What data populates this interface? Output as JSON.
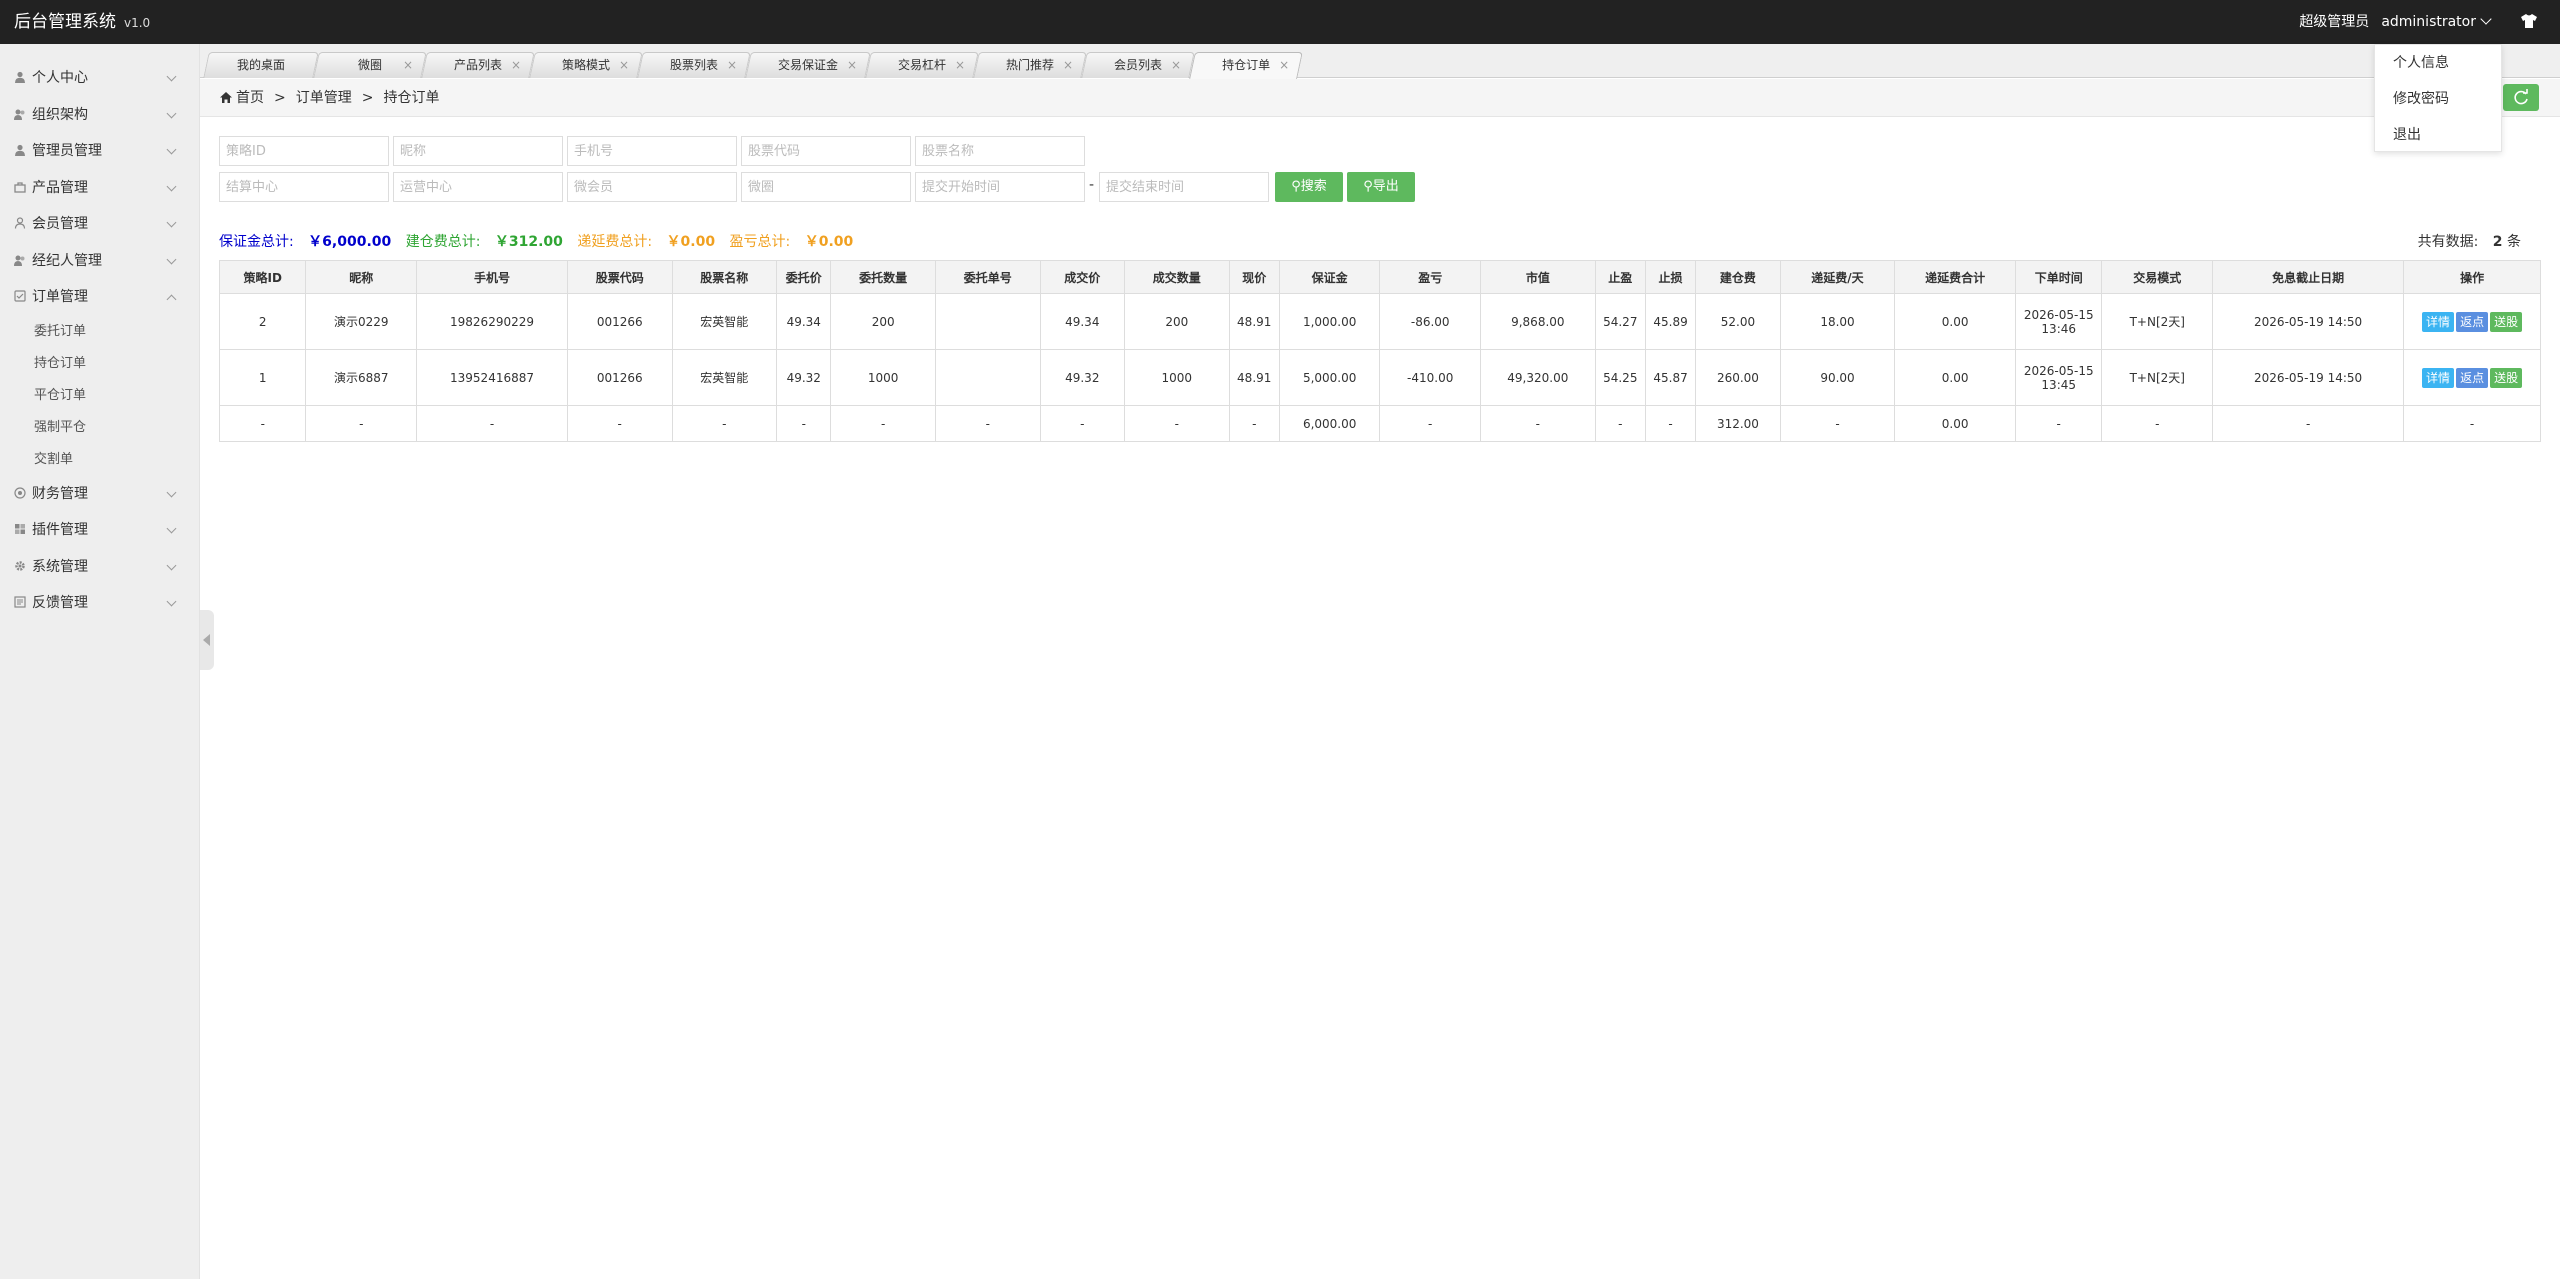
{
  "app": {
    "title": "后台管理系统",
    "version": "v1.0"
  },
  "user": {
    "role": "超级管理员",
    "name": "administrator"
  },
  "user_menu": [
    "个人信息",
    "修改密码",
    "退出"
  ],
  "sidebar": {
    "items": [
      {
        "label": "个人中心",
        "icon": "user-icon"
      },
      {
        "label": "组织架构",
        "icon": "org-icon"
      },
      {
        "label": "管理员管理",
        "icon": "admin-icon"
      },
      {
        "label": "产品管理",
        "icon": "product-icon"
      },
      {
        "label": "会员管理",
        "icon": "member-icon"
      },
      {
        "label": "经纪人管理",
        "icon": "broker-icon"
      },
      {
        "label": "订单管理",
        "icon": "order-icon",
        "expanded": true,
        "children": [
          "委托订单",
          "持仓订单",
          "平仓订单",
          "强制平仓",
          "交割单"
        ]
      },
      {
        "label": "财务管理",
        "icon": "finance-icon"
      },
      {
        "label": "插件管理",
        "icon": "plugin-icon"
      },
      {
        "label": "系统管理",
        "icon": "system-icon"
      },
      {
        "label": "反馈管理",
        "icon": "feedback-icon"
      }
    ]
  },
  "tabs": [
    "我的桌面",
    "微圈",
    "产品列表",
    "策略模式",
    "股票列表",
    "交易保证金",
    "交易杠杆",
    "热门推荐",
    "会员列表",
    "持仓订单"
  ],
  "breadcrumb": {
    "home": "首页",
    "level1": "订单管理",
    "level2": "持仓订单"
  },
  "search": {
    "placeholders": {
      "strategy_id": "策略ID",
      "nickname": "昵称",
      "phone": "手机号",
      "stock_code": "股票代码",
      "stock_name": "股票名称",
      "settle_center": "结算中心",
      "ops_center": "运营中心",
      "micro_member": "微会员",
      "micro_circle": "微圈",
      "start_time": "提交开始时间",
      "end_time": "提交结束时间"
    },
    "dash": "-",
    "search_label": "搜索",
    "export_label": "导出"
  },
  "summary": {
    "margin_label": "保证金总计:",
    "margin_value": "￥6,000.00",
    "build_fee_label": "建仓费总计:",
    "build_fee_value": "￥312.00",
    "defer_fee_label": "递延费总计:",
    "defer_fee_value": "￥0.00",
    "pnl_label": "盈亏总计:",
    "pnl_value": "￥0.00",
    "count_label": "共有数据:",
    "count_value": "2",
    "count_unit": "条",
    "colors": {
      "margin": "#0000cc",
      "build_fee": "#2fa533",
      "defer_fee": "#f0a020",
      "pnl": "#f0a020"
    }
  },
  "table": {
    "columns": [
      "策略ID",
      "昵称",
      "手机号",
      "股票代码",
      "股票名称",
      "委托价",
      "委托数量",
      "委托单号",
      "成交价",
      "成交数量",
      "现价",
      "保证金",
      "盈亏",
      "市值",
      "止盈",
      "止损",
      "建仓费",
      "递延费/天",
      "递延费合计",
      "下单时间",
      "交易模式",
      "免息截止日期",
      "操作"
    ],
    "rows": [
      {
        "id": "2",
        "nickname": "演示0229",
        "phone": "19826290229",
        "code": "001266",
        "name": "宏英智能",
        "entrust_price": "49.34",
        "entrust_qty": "200",
        "entrust_no": "",
        "deal_price": "49.34",
        "deal_qty": "200",
        "price": "48.91",
        "margin": "1,000.00",
        "pnl": "-86.00",
        "market_value": "9,868.00",
        "take_profit": "54.27",
        "stop_loss": "45.89",
        "build_fee": "52.00",
        "defer_day": "18.00",
        "defer_total": "0.00",
        "order_date": "2026-05-15",
        "order_time": "13:46",
        "mode": "T+N[2天]",
        "free_until": "2026-05-19 14:50"
      },
      {
        "id": "1",
        "nickname": "演示6887",
        "phone": "13952416887",
        "code": "001266",
        "name": "宏英智能",
        "entrust_price": "49.32",
        "entrust_qty": "1000",
        "entrust_no": "",
        "deal_price": "49.32",
        "deal_qty": "1000",
        "price": "48.91",
        "margin": "5,000.00",
        "pnl": "-410.00",
        "market_value": "49,320.00",
        "take_profit": "54.25",
        "stop_loss": "45.87",
        "build_fee": "260.00",
        "defer_day": "90.00",
        "defer_total": "0.00",
        "order_date": "2026-05-15",
        "order_time": "13:45",
        "mode": "T+N[2天]",
        "free_until": "2026-05-19 14:50"
      }
    ],
    "total_row": [
      "-",
      "-",
      "-",
      "-",
      "-",
      "-",
      "-",
      "-",
      "-",
      "-",
      "-",
      "6,000.00",
      "-",
      "-",
      "-",
      "-",
      "312.00",
      "-",
      "0.00",
      "-",
      "-",
      "-",
      "-"
    ],
    "actions": [
      "详情",
      "返点",
      "送股"
    ]
  }
}
